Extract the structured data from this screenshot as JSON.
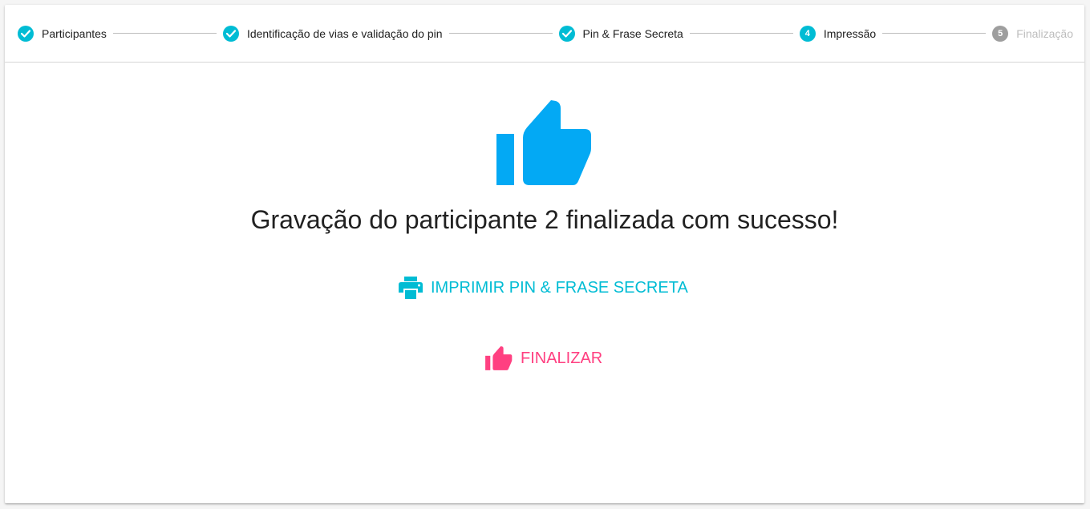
{
  "stepper": {
    "steps": [
      {
        "label": "Participantes",
        "state": "completed",
        "icon": "check-icon"
      },
      {
        "label": "Identificação de vias e validação do pin",
        "state": "completed",
        "icon": "check-icon"
      },
      {
        "label": "Pin & Frase Secreta",
        "state": "completed",
        "icon": "check-icon"
      },
      {
        "label": "Impressão",
        "state": "active",
        "number": "4"
      },
      {
        "label": "Finalização",
        "state": "disabled",
        "number": "5"
      }
    ]
  },
  "main": {
    "hero_icon": "thumbs-up-icon",
    "title": "Gravação do participante 2 finalizada com sucesso!",
    "print_button": {
      "label": "IMPRIMIR PIN & FRASE SECRETA",
      "icon": "printer-icon"
    },
    "finish_button": {
      "label": "FINALIZAR",
      "icon": "thumbs-up-icon"
    }
  },
  "colors": {
    "accent": "#00bcd4",
    "hero": "#03a9f4",
    "finish": "#ff4081",
    "disabled": "#9e9e9e",
    "text": "#212121",
    "disabled_text": "#bdbdbd"
  }
}
